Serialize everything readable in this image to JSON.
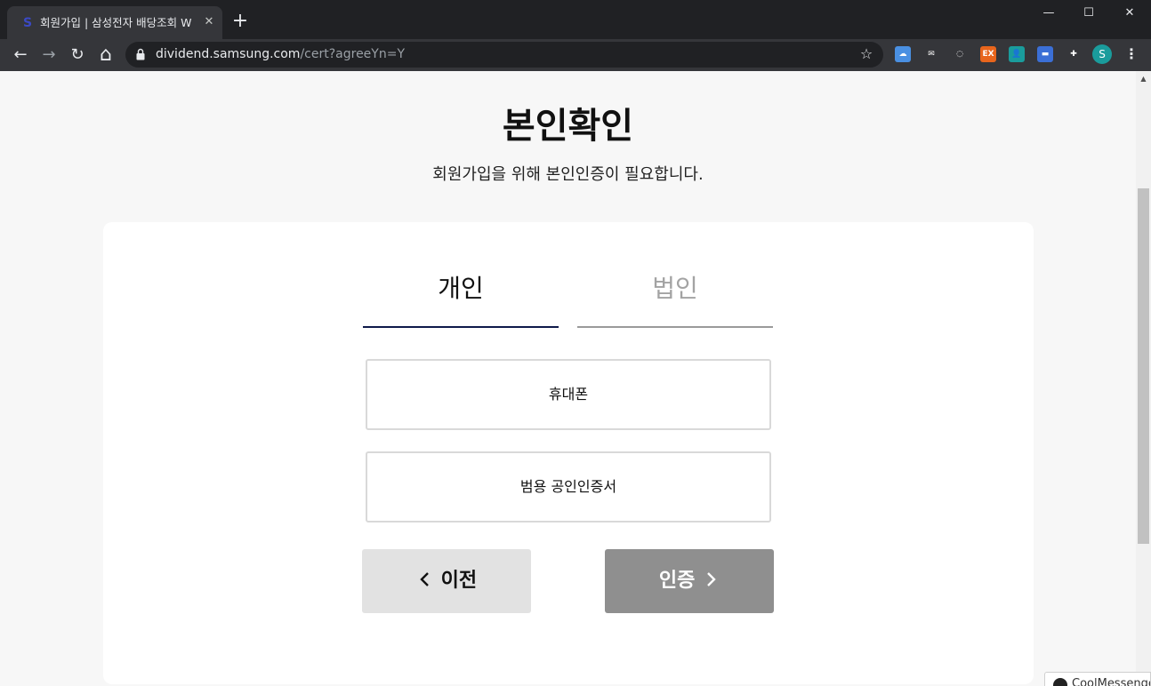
{
  "browser": {
    "tab": {
      "favicon": "S",
      "title": "회원가입 | 삼성전자 배당조회 W",
      "close": "✕"
    },
    "new_tab": "+",
    "window": {
      "minimize": "—",
      "maximize": "☐",
      "close": "✕"
    },
    "nav": {
      "back": "←",
      "forward": "→",
      "reload": "↻",
      "home": "⌂"
    },
    "url_host": "dividend.samsung.com",
    "url_path": "/cert?agreeYn=Y",
    "star": "☆",
    "extensions": [
      {
        "name": "cloud-extension-icon",
        "label": "☁",
        "color": "#4a90e2"
      },
      {
        "name": "mail-extension-icon",
        "label": "✉",
        "color": "#35363a"
      },
      {
        "name": "shield-extension-icon",
        "label": "◌",
        "color": "#35363a"
      },
      {
        "name": "ex-extension-icon",
        "label": "EX",
        "color": "#e8651c"
      },
      {
        "name": "contact-extension-icon",
        "label": "👤",
        "color": "#1a9c9c"
      },
      {
        "name": "window-extension-icon",
        "label": "▬",
        "color": "#3b6fd6"
      },
      {
        "name": "puzzle-extension-icon",
        "label": "✚",
        "color": "#35363a"
      }
    ],
    "profile_initial": "S",
    "menu": "⋮"
  },
  "page": {
    "title": "본인확인",
    "subtitle": "회원가입을 위해 본인인증이 필요합니다.",
    "tabs": [
      {
        "label": "개인",
        "active": true
      },
      {
        "label": "법인",
        "active": false
      }
    ],
    "options": [
      {
        "label": "휴대폰"
      },
      {
        "label": "범용 공인인증서"
      }
    ],
    "prev_button": "이전",
    "cert_button": "인증"
  },
  "overlay": {
    "text": "CoolMessenger"
  },
  "colors": {
    "tab_active_underline": "#0f1a4a",
    "cert_button_bg": "#8f8f8f",
    "prev_button_bg": "#e2e2e2"
  }
}
